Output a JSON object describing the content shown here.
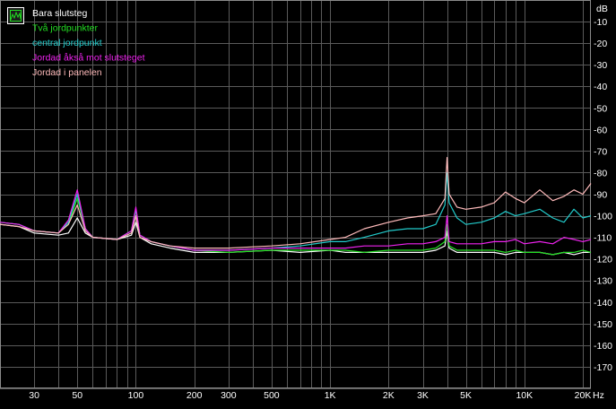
{
  "chart_data": {
    "type": "line",
    "xscale": "log",
    "xlim": [
      20,
      22000
    ],
    "ylim": [
      -180,
      0
    ],
    "y_unit": "dB",
    "x_unit": "Hz",
    "grid": true,
    "legend_position": "top-left",
    "x_ticks": [
      {
        "value": 30,
        "label": "30"
      },
      {
        "value": 50,
        "label": "50"
      },
      {
        "value": 100,
        "label": "100"
      },
      {
        "value": 200,
        "label": "200"
      },
      {
        "value": 300,
        "label": "300"
      },
      {
        "value": 500,
        "label": "500"
      },
      {
        "value": 1000,
        "label": "1K"
      },
      {
        "value": 2000,
        "label": "2K"
      },
      {
        "value": 3000,
        "label": "3K"
      },
      {
        "value": 5000,
        "label": "5K"
      },
      {
        "value": 10000,
        "label": "10K"
      },
      {
        "value": 20000,
        "label": "20K"
      }
    ],
    "y_ticks": [
      -10,
      -20,
      -30,
      -40,
      -50,
      -60,
      -70,
      -80,
      -90,
      -100,
      -110,
      -120,
      -130,
      -140,
      -150,
      -160,
      -170
    ],
    "colors": {
      "background": "#000000",
      "grid": "#5a5a5a",
      "axis_text": "#ffffff"
    },
    "series": [
      {
        "name": "Bara slutsteg",
        "color": "#ffffff",
        "x": [
          20,
          25,
          30,
          40,
          45,
          50,
          55,
          60,
          80,
          95,
          100,
          105,
          120,
          150,
          200,
          300,
          500,
          700,
          1000,
          1200,
          1500,
          2000,
          2500,
          3000,
          3500,
          3900,
          4000,
          4100,
          4500,
          5000,
          6000,
          7000,
          8000,
          9000,
          10000,
          12000,
          14000,
          16000,
          18000,
          20000,
          22000
        ],
        "y": [
          -104,
          -105,
          -108,
          -109,
          -108,
          -101,
          -108,
          -110,
          -111,
          -109,
          -103,
          -110,
          -113,
          -115,
          -117,
          -117,
          -116,
          -117,
          -116,
          -117,
          -117,
          -117,
          -117,
          -117,
          -116,
          -114,
          -107,
          -115,
          -117,
          -117,
          -117,
          -117,
          -118,
          -117,
          -117,
          -117,
          -118,
          -117,
          -118,
          -117,
          -117
        ]
      },
      {
        "name": "Två jordpunkter",
        "color": "#22dd22",
        "x": [
          20,
          25,
          30,
          40,
          45,
          50,
          55,
          60,
          80,
          95,
          100,
          105,
          120,
          150,
          200,
          300,
          500,
          700,
          1000,
          1200,
          1500,
          2000,
          2500,
          3000,
          3500,
          3900,
          4000,
          4100,
          4500,
          5000,
          6000,
          7000,
          8000,
          9000,
          10000,
          12000,
          14000,
          16000,
          18000,
          20000,
          22000
        ],
        "y": [
          -103,
          -104,
          -107,
          -108,
          -104,
          -92,
          -106,
          -110,
          -111,
          -107,
          -97,
          -109,
          -112,
          -114,
          -116,
          -117,
          -116,
          -116,
          -116,
          -116,
          -117,
          -116,
          -116,
          -116,
          -115,
          -112,
          -104,
          -114,
          -116,
          -116,
          -116,
          -116,
          -117,
          -116,
          -117,
          -117,
          -118,
          -117,
          -117,
          -116,
          -117
        ]
      },
      {
        "name": "central jordpunkt",
        "color": "#22cccc",
        "x": [
          20,
          25,
          30,
          40,
          45,
          50,
          55,
          60,
          80,
          95,
          100,
          105,
          120,
          150,
          200,
          300,
          500,
          700,
          1000,
          1200,
          1500,
          2000,
          2500,
          3000,
          3500,
          3900,
          4000,
          4100,
          4500,
          5000,
          6000,
          7000,
          8000,
          9000,
          10000,
          12000,
          14000,
          16000,
          18000,
          20000,
          22000
        ],
        "y": [
          -103,
          -104,
          -107,
          -108,
          -103,
          -90,
          -106,
          -110,
          -111,
          -107,
          -97,
          -109,
          -112,
          -114,
          -116,
          -116,
          -115,
          -114,
          -112,
          -112,
          -110,
          -107,
          -106,
          -106,
          -104,
          -95,
          -80,
          -94,
          -101,
          -104,
          -103,
          -101,
          -98,
          -100,
          -99,
          -97,
          -101,
          -103,
          -97,
          -101,
          -100
        ]
      },
      {
        "name": "Jordad åkså mot slutsteget",
        "color": "#ee22ee",
        "x": [
          20,
          25,
          30,
          40,
          45,
          50,
          55,
          60,
          80,
          95,
          100,
          105,
          120,
          150,
          200,
          300,
          500,
          700,
          1000,
          1200,
          1500,
          2000,
          2500,
          3000,
          3500,
          3900,
          4000,
          4100,
          4500,
          5000,
          6000,
          7000,
          8000,
          9000,
          10000,
          12000,
          14000,
          16000,
          18000,
          20000,
          22000
        ],
        "y": [
          -103,
          -104,
          -107,
          -108,
          -102,
          -88,
          -106,
          -110,
          -111,
          -107,
          -96,
          -109,
          -112,
          -114,
          -116,
          -116,
          -115,
          -115,
          -115,
          -115,
          -114,
          -114,
          -113,
          -113,
          -112,
          -110,
          -100,
          -112,
          -113,
          -113,
          -113,
          -112,
          -112,
          -111,
          -113,
          -112,
          -113,
          -110,
          -111,
          -112,
          -111
        ]
      },
      {
        "name": "Jordad i panelen",
        "color": "#ffbbbb",
        "x": [
          20,
          25,
          30,
          40,
          45,
          50,
          55,
          60,
          80,
          95,
          100,
          105,
          120,
          150,
          200,
          300,
          500,
          700,
          1000,
          1200,
          1500,
          2000,
          2500,
          3000,
          3500,
          3900,
          4000,
          4100,
          4500,
          5000,
          6000,
          7000,
          8000,
          9000,
          10000,
          12000,
          14000,
          16000,
          18000,
          20000,
          22000
        ],
        "y": [
          -104,
          -105,
          -107,
          -108,
          -104,
          -95,
          -107,
          -110,
          -111,
          -108,
          -100,
          -110,
          -112,
          -114,
          -115,
          -115,
          -114,
          -113,
          -111,
          -110,
          -106,
          -103,
          -101,
          -100,
          -99,
          -92,
          -73,
          -90,
          -96,
          -97,
          -96,
          -94,
          -89,
          -92,
          -94,
          -88,
          -93,
          -91,
          -88,
          -90,
          -85
        ]
      }
    ]
  }
}
